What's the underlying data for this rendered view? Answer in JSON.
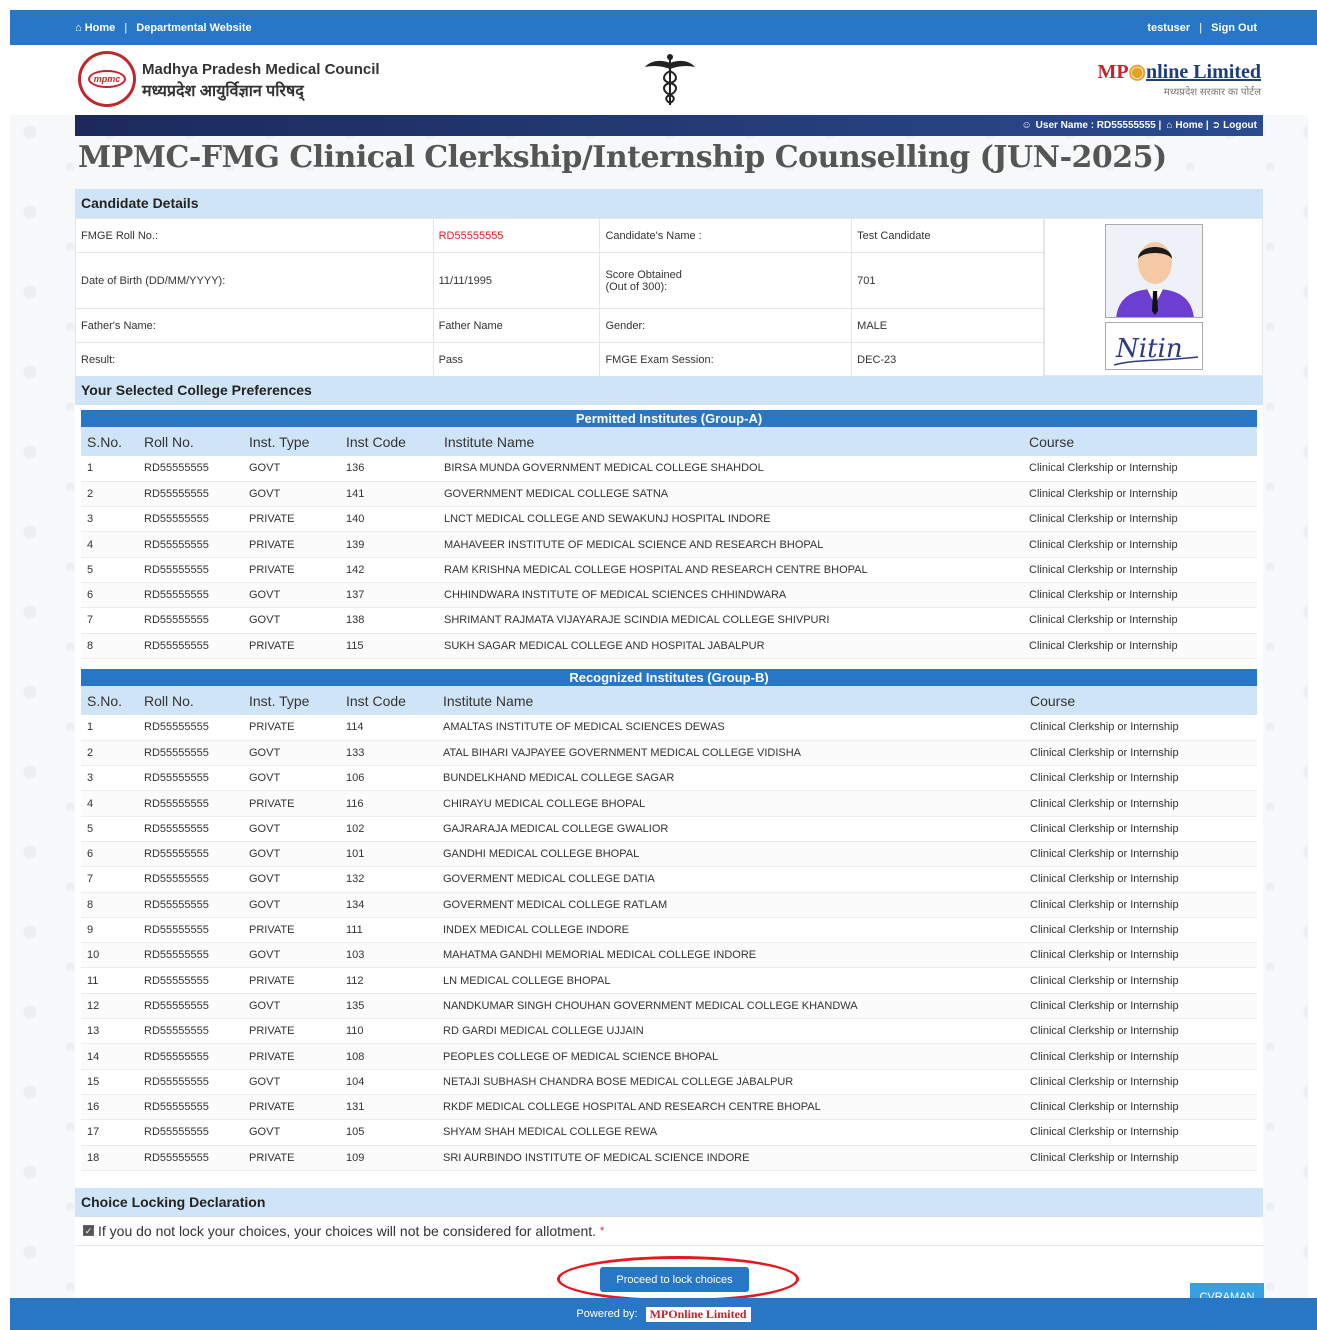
{
  "topbar": {
    "home": "Home",
    "departmental": "Departmental Website",
    "user": "testuser",
    "signout": "Sign Out"
  },
  "header": {
    "logo_text": "mpmc",
    "council_en": "Madhya Pradesh Medical Council",
    "council_hi": "मध्यप्रदेश आयुर्विज्ञान परिषद्",
    "brand_mp": "MP",
    "brand_rest": "nline Limited",
    "brand_sub": "मध्यप्रदेश सरकार का पोर्टल"
  },
  "userbar": {
    "username": "User Name : RD55555555 |",
    "home": "Home |",
    "logout": "Logout"
  },
  "page_title": "MPMC-FMG Clinical Clerkship/Internship Counselling (JUN-2025)",
  "candidate": {
    "heading": "Candidate Details",
    "roll_label": "FMGE Roll No.:",
    "roll_value": "RD55555555",
    "name_label": "Candidate's Name :",
    "name_value": "Test Candidate",
    "dob_label": "Date of Birth (DD/MM/YYYY):",
    "dob_value": "11/11/1995",
    "score_label": "Score Obtained",
    "score_label2": "(Out of 300):",
    "score_value": "701",
    "father_label": "Father's Name:",
    "father_value": "Father Name",
    "gender_label": "Gender:",
    "gender_value": "MALE",
    "result_label": "Result:",
    "result_value": "Pass",
    "session_label": "FMGE Exam Session:",
    "session_value": "DEC-23",
    "signature_text": "Nitin"
  },
  "preferences_heading": "Your Selected College Preferences",
  "columns": [
    "S.No.",
    "Roll No.",
    "Inst. Type",
    "Inst Code",
    "Institute Name",
    "Course"
  ],
  "group_a": {
    "title": "Permitted Institutes (Group-A)",
    "rows": [
      [
        "1",
        "RD55555555",
        "GOVT",
        "136",
        "BIRSA MUNDA GOVERNMENT MEDICAL COLLEGE SHAHDOL",
        "Clinical Clerkship or Internship"
      ],
      [
        "2",
        "RD55555555",
        "GOVT",
        "141",
        "GOVERNMENT MEDICAL COLLEGE SATNA",
        "Clinical Clerkship or Internship"
      ],
      [
        "3",
        "RD55555555",
        "PRIVATE",
        "140",
        "LNCT MEDICAL COLLEGE AND SEWAKUNJ HOSPITAL INDORE",
        "Clinical Clerkship or Internship"
      ],
      [
        "4",
        "RD55555555",
        "PRIVATE",
        "139",
        "MAHAVEER INSTITUTE OF MEDICAL SCIENCE AND RESEARCH BHOPAL",
        "Clinical Clerkship or Internship"
      ],
      [
        "5",
        "RD55555555",
        "PRIVATE",
        "142",
        "RAM KRISHNA MEDICAL COLLEGE HOSPITAL AND RESEARCH CENTRE BHOPAL",
        "Clinical Clerkship or Internship"
      ],
      [
        "6",
        "RD55555555",
        "GOVT",
        "137",
        "CHHINDWARA INSTITUTE OF MEDICAL SCIENCES CHHINDWARA",
        "Clinical Clerkship or Internship"
      ],
      [
        "7",
        "RD55555555",
        "GOVT",
        "138",
        "SHRIMANT RAJMATA VIJAYARAJE SCINDIA MEDICAL COLLEGE SHIVPURI",
        "Clinical Clerkship or Internship"
      ],
      [
        "8",
        "RD55555555",
        "PRIVATE",
        "115",
        "SUKH SAGAR MEDICAL COLLEGE AND HOSPITAL JABALPUR",
        "Clinical Clerkship or Internship"
      ]
    ]
  },
  "group_b": {
    "title": "Recognized Institutes (Group-B)",
    "rows": [
      [
        "1",
        "RD55555555",
        "PRIVATE",
        "114",
        "AMALTAS INSTITUTE OF MEDICAL SCIENCES DEWAS",
        "Clinical Clerkship or Internship"
      ],
      [
        "2",
        "RD55555555",
        "GOVT",
        "133",
        "ATAL BIHARI VAJPAYEE GOVERNMENT MEDICAL COLLEGE VIDISHA",
        "Clinical Clerkship or Internship"
      ],
      [
        "3",
        "RD55555555",
        "GOVT",
        "106",
        "BUNDELKHAND MEDICAL COLLEGE SAGAR",
        "Clinical Clerkship or Internship"
      ],
      [
        "4",
        "RD55555555",
        "PRIVATE",
        "116",
        "CHIRAYU MEDICAL COLLEGE BHOPAL",
        "Clinical Clerkship or Internship"
      ],
      [
        "5",
        "RD55555555",
        "GOVT",
        "102",
        "GAJRARAJA MEDICAL COLLEGE GWALIOR",
        "Clinical Clerkship or Internship"
      ],
      [
        "6",
        "RD55555555",
        "GOVT",
        "101",
        "GANDHI MEDICAL COLLEGE BHOPAL",
        "Clinical Clerkship or Internship"
      ],
      [
        "7",
        "RD55555555",
        "GOVT",
        "132",
        "GOVERMENT MEDICAL COLLEGE DATIA",
        "Clinical Clerkship or Internship"
      ],
      [
        "8",
        "RD55555555",
        "GOVT",
        "134",
        "GOVERMENT MEDICAL COLLEGE RATLAM",
        "Clinical Clerkship or Internship"
      ],
      [
        "9",
        "RD55555555",
        "PRIVATE",
        "111",
        "INDEX MEDICAL COLLEGE INDORE",
        "Clinical Clerkship or Internship"
      ],
      [
        "10",
        "RD55555555",
        "GOVT",
        "103",
        "MAHATMA GANDHI MEMORIAL MEDICAL COLLEGE INDORE",
        "Clinical Clerkship or Internship"
      ],
      [
        "11",
        "RD55555555",
        "PRIVATE",
        "112",
        "LN MEDICAL COLLEGE BHOPAL",
        "Clinical Clerkship or Internship"
      ],
      [
        "12",
        "RD55555555",
        "GOVT",
        "135",
        "NANDKUMAR SINGH CHOUHAN GOVERNMENT MEDICAL COLLEGE KHANDWA",
        "Clinical Clerkship or Internship"
      ],
      [
        "13",
        "RD55555555",
        "PRIVATE",
        "110",
        "RD GARDI MEDICAL COLLEGE UJJAIN",
        "Clinical Clerkship or Internship"
      ],
      [
        "14",
        "RD55555555",
        "PRIVATE",
        "108",
        "PEOPLES COLLEGE OF MEDICAL SCIENCE BHOPAL",
        "Clinical Clerkship or Internship"
      ],
      [
        "15",
        "RD55555555",
        "GOVT",
        "104",
        "NETAJI SUBHASH CHANDRA BOSE MEDICAL COLLEGE JABALPUR",
        "Clinical Clerkship or Internship"
      ],
      [
        "16",
        "RD55555555",
        "PRIVATE",
        "131",
        "RKDF MEDICAL COLLEGE HOSPITAL AND RESEARCH CENTRE BHOPAL",
        "Clinical Clerkship or Internship"
      ],
      [
        "17",
        "RD55555555",
        "GOVT",
        "105",
        "SHYAM SHAH MEDICAL COLLEGE REWA",
        "Clinical Clerkship or Internship"
      ],
      [
        "18",
        "RD55555555",
        "PRIVATE",
        "109",
        "SRI AURBINDO INSTITUTE OF MEDICAL SCIENCE INDORE",
        "Clinical Clerkship or Internship"
      ]
    ]
  },
  "declaration": {
    "heading": "Choice Locking Declaration",
    "text": "If you do not lock your choices, your choices will not be considered for allotment.",
    "required_mark": "*"
  },
  "proceed_button": "Proceed to lock choices",
  "footer": {
    "powered_by": "Powered by:",
    "logo": "MPOnline Limited"
  },
  "cvraman": "CVRAMAN",
  "colors": {
    "primary": "#2877c7",
    "section_bg": "#cfe5f7",
    "brand_red": "#c0262c",
    "highlight_oval": "#e3191e"
  }
}
